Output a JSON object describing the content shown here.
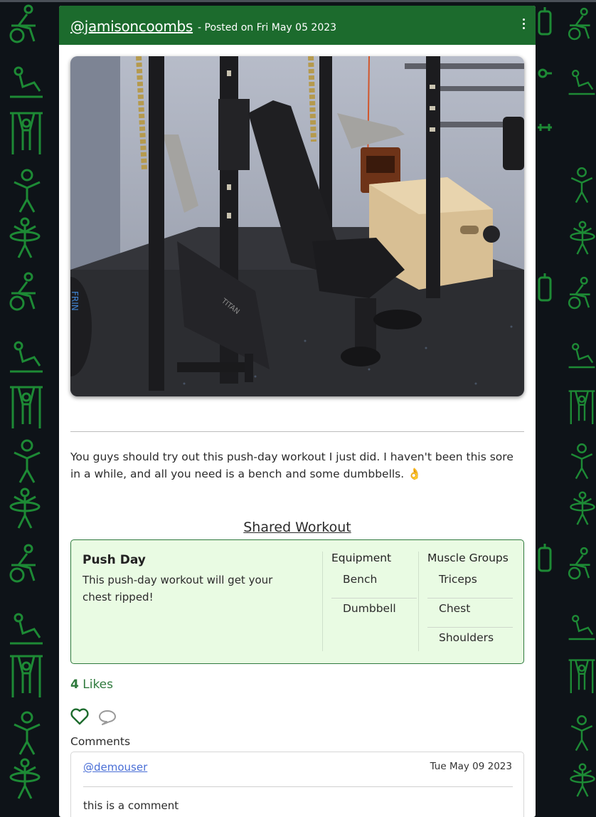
{
  "post": {
    "username": "@jamisoncoombs",
    "posted_label": "- Posted on Fri May 05 2023",
    "body": "You guys should try out this push-day workout I just did. I haven't been this sore in a while, and all you need is a bench and some dumbbells. 👌",
    "photo_brand_text": "TITAN",
    "photo_plate_text": "FRIN"
  },
  "shared_workout": {
    "section_title": "Shared Workout",
    "name": "Push Day",
    "description": "This push-day workout will get your chest ripped!",
    "equipment_header": "Equipment",
    "equipment": [
      "Bench",
      "Dumbbell"
    ],
    "muscle_header": "Muscle Groups",
    "muscles": [
      "Triceps",
      "Chest",
      "Shoulders"
    ]
  },
  "likes": {
    "count": "4",
    "label": "Likes"
  },
  "comments": {
    "label": "Comments",
    "items": [
      {
        "user": "@demouser",
        "date": "Tue May 09 2023",
        "text": "this is a comment"
      }
    ]
  },
  "colors": {
    "header": "#1c6b2d",
    "accent": "#2f7a3d",
    "workout_bg": "#e9fbe3",
    "page_bg": "#0e1318",
    "pattern": "#1d8a35"
  },
  "icons": {
    "menu": "more-vertical-icon",
    "like": "heart-icon",
    "comment": "comment-icon",
    "background": "fitness-pattern-icons"
  }
}
